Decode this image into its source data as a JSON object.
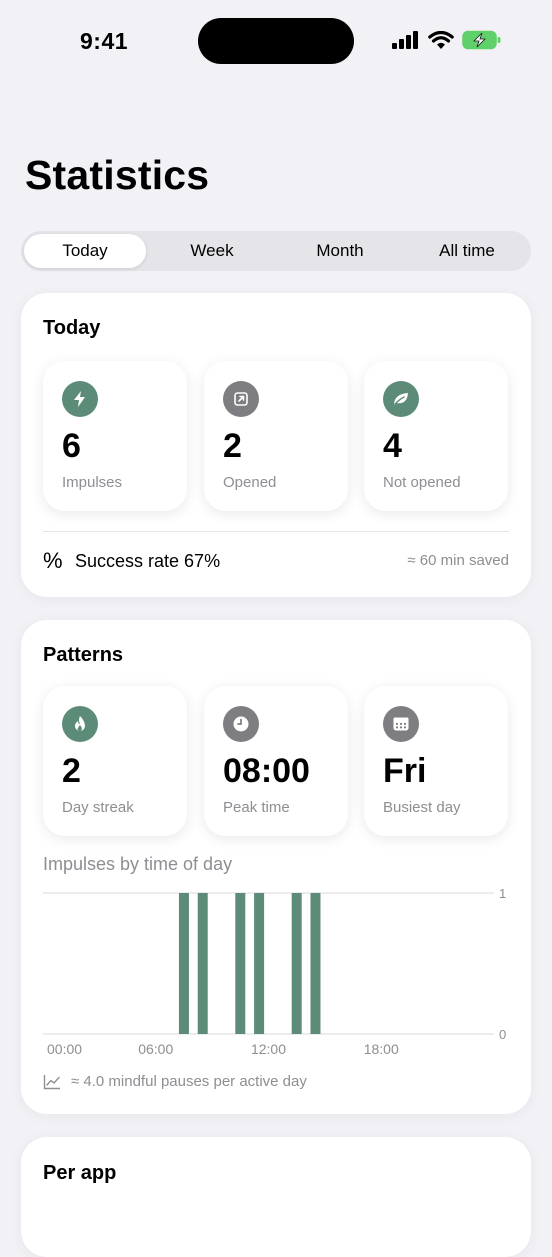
{
  "status_bar": {
    "time": "9:41"
  },
  "page": {
    "title": "Statistics"
  },
  "tabs": [
    {
      "label": "Today"
    },
    {
      "label": "Week"
    },
    {
      "label": "Month"
    },
    {
      "label": "All time"
    }
  ],
  "active_tab": "Today",
  "today": {
    "title": "Today",
    "tiles": [
      {
        "value": "6",
        "label": "Impulses",
        "icon": "bolt-icon",
        "color": "#5C8C78"
      },
      {
        "value": "2",
        "label": "Opened",
        "icon": "open-external-icon",
        "color": "#7D7D82"
      },
      {
        "value": "4",
        "label": "Not opened",
        "icon": "leaf-icon",
        "color": "#5C8C78"
      }
    ],
    "success_symbol": "%",
    "success_text": "Success rate 67%",
    "saved_text": "≈ 60 min saved"
  },
  "patterns": {
    "title": "Patterns",
    "tiles": [
      {
        "value": "2",
        "label": "Day streak",
        "icon": "flame-icon",
        "color": "#5C8C78"
      },
      {
        "value": "08:00",
        "label": "Peak time",
        "icon": "clock-icon",
        "color": "#7D7D82"
      },
      {
        "value": "Fri",
        "label": "Busiest day",
        "icon": "calendar-icon",
        "color": "#7D7D82"
      }
    ],
    "chart_title": "Impulses by time of day",
    "footer_text": "≈ 4.0 mindful pauses per active day"
  },
  "per_app": {
    "title": "Per app"
  },
  "chart_data": {
    "type": "bar",
    "title": "Impulses by time of day",
    "xlabel": "",
    "ylabel": "",
    "x_tick_labels": [
      "00:00",
      "06:00",
      "12:00",
      "18:00"
    ],
    "y_tick_labels": [
      "1",
      "0"
    ],
    "xlim": [
      0,
      24
    ],
    "ylim": [
      0,
      1
    ],
    "x": [
      7.5,
      8.5,
      10.5,
      11.5,
      13.5,
      14.5
    ],
    "values": [
      1,
      1,
      1,
      1,
      1,
      1
    ],
    "bar_color": "#5C8C78",
    "grid": "horizontal"
  }
}
